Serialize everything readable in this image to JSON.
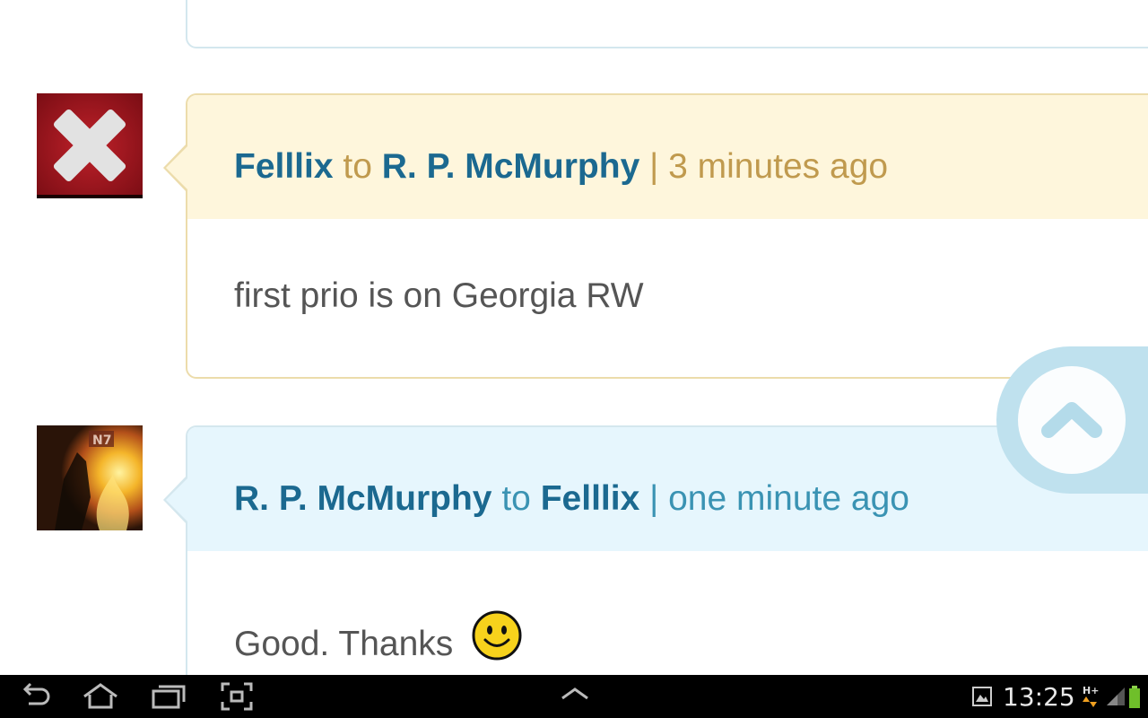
{
  "comments": [
    {
      "author": "Felllix",
      "connector": "to",
      "recipient": "R. P. McMurphy",
      "separator": "|",
      "time": "3 minutes ago",
      "message": "first prio is on Georgia RW",
      "avatar": "red-x-avatar"
    },
    {
      "author": "R. P. McMurphy",
      "connector": "to",
      "recipient": "Felllix",
      "separator": "|",
      "time": "one minute ago",
      "message": "Good. Thanks",
      "avatar": "n7-fire-avatar",
      "emoji": "smiley-icon"
    }
  ],
  "status_bar": {
    "clock": "13:25",
    "network": "H+"
  },
  "colors": {
    "name": "#1b6990",
    "card1_header": "#fef6dc",
    "card1_meta": "#c09a4e",
    "card2_header": "#e6f6fd",
    "card2_meta": "#3a93b3"
  }
}
